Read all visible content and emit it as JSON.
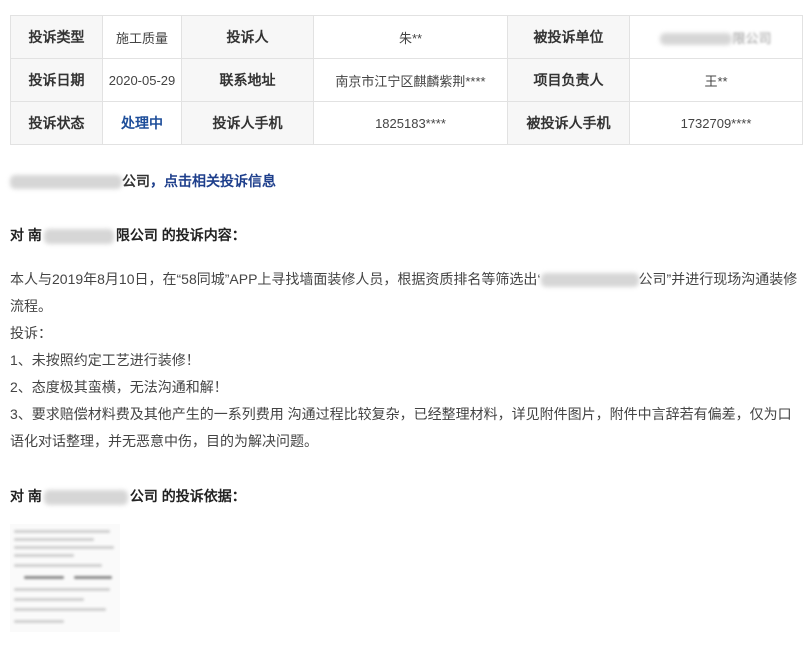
{
  "table": {
    "row1": {
      "type_label": "投诉类型",
      "type_value": "施工质量",
      "complainant_label": "投诉人",
      "complainant_value": "朱**",
      "target_label": "被投诉单位",
      "target_value_visible": "限公司"
    },
    "row2": {
      "date_label": "投诉日期",
      "date_value": "2020-05-29",
      "address_label": "联系地址",
      "address_value": "南京市江宁区麒麟紫荆****",
      "manager_label": "项目负责人",
      "manager_value": "王**"
    },
    "row3": {
      "status_label": "投诉状态",
      "status_value": "处理中",
      "phone_label": "投诉人手机",
      "phone_value": "1825183****",
      "target_phone_label": "被投诉人手机",
      "target_phone_value": "1732709****"
    }
  },
  "related": {
    "company_suffix": "公司",
    "link_text": "，点击相关投诉信息"
  },
  "complaint_content": {
    "title_prefix": "对 南",
    "title_suffix": "限公司 的投诉内容：",
    "p1_before": "本人与2019年8月10日，在“58同城”APP上寻找墙面装修人员，根据资质排名等筛选出‘",
    "p1_after": "公司”并进行现场沟通装修流程。",
    "p2": "投诉：",
    "p3": "1、未按照约定工艺进行装修！",
    "p4": "2、态度极其蛮横，无法沟通和解！",
    "p5": "3、要求赔偿材料费及其他产生的一系列费用 沟通过程比较复杂，已经整理材料，详见附件图片，附件中言辞若有偏差，仅为口语化对话整理，并无恶意中伤，目的为解决问题。"
  },
  "complaint_basis": {
    "title_prefix": "对 南",
    "title_suffix": "公司 的投诉依据："
  },
  "colors": {
    "label_bg": "#f7f7f7",
    "border": "#e2e2e2",
    "link": "#1e3f8c",
    "status": "#1e4e9a"
  }
}
